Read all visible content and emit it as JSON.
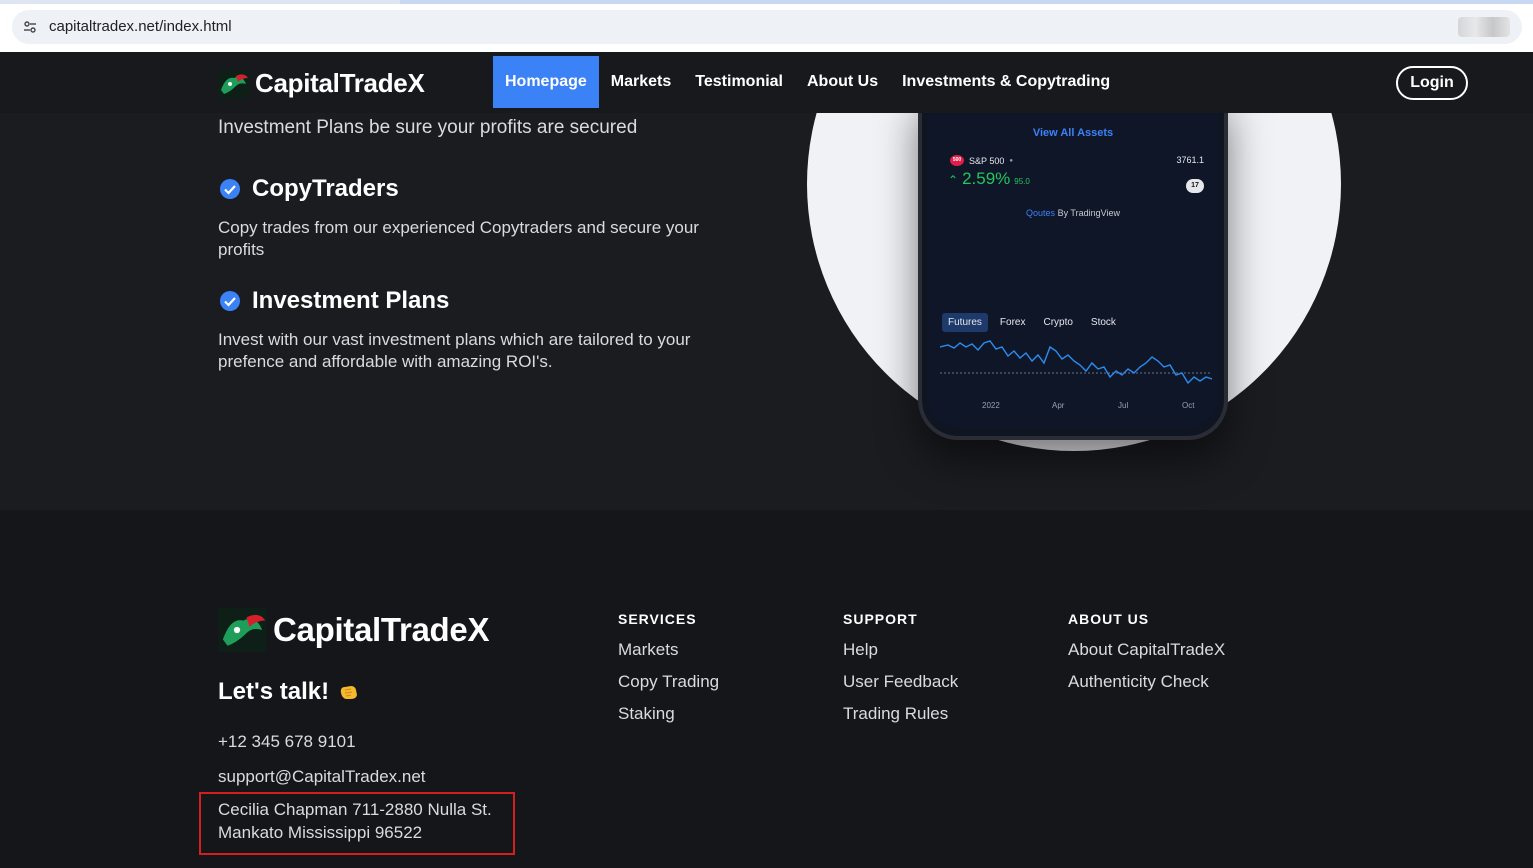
{
  "browser": {
    "url": "capitaltradex.net/index.html"
  },
  "nav": {
    "brand": "CapitalTradeX",
    "links": [
      "Homepage",
      "Markets",
      "Testimonial",
      "About Us",
      "Investments & Copytrading"
    ],
    "login": "Login"
  },
  "hero": {
    "cut_line": "Investment Plans be sure your profits are secured",
    "features": [
      {
        "title": "CopyTraders",
        "desc": "Copy trades from our experienced Copytraders and secure your profits"
      },
      {
        "title": "Investment Plans",
        "desc": "Invest with our vast investment plans which are tailored to your prefence and affordable with amazing ROI's."
      }
    ]
  },
  "widget": {
    "view_all": "View All Assets",
    "symbol_badge": "500",
    "symbol": "S&P 500",
    "price": "3761.1",
    "change": "2.59%",
    "change_abs": "95.0",
    "tv_badge": "17",
    "quotes_link": "Qoutes",
    "quotes_rest": "By TradingView",
    "tabs": [
      "Futures",
      "Forex",
      "Crypto",
      "Stock"
    ],
    "active_tab": "Futures",
    "x_labels": [
      "2022",
      "Apr",
      "Jul",
      "Oct"
    ],
    "accent": "#3b82f6",
    "positive": "#22c55e"
  },
  "footer": {
    "brand": "CapitalTradeX",
    "lets_talk": "Let's talk!",
    "phone": "+12 345 678 9101",
    "email": "support@CapitalTradex.net",
    "address_line1": "Cecilia Chapman 711-2880 Nulla St.",
    "address_line2": "Mankato Mississippi 96522",
    "highlight_color": "#d41f1f",
    "columns": [
      {
        "title": "SERVICES",
        "links": [
          "Markets",
          "Copy Trading",
          "Staking"
        ]
      },
      {
        "title": "SUPPORT",
        "links": [
          "Help",
          "User Feedback",
          "Trading Rules"
        ]
      },
      {
        "title": "ABOUT US",
        "links": [
          "About CapitalTradeX",
          "Authenticity Check"
        ]
      }
    ]
  }
}
